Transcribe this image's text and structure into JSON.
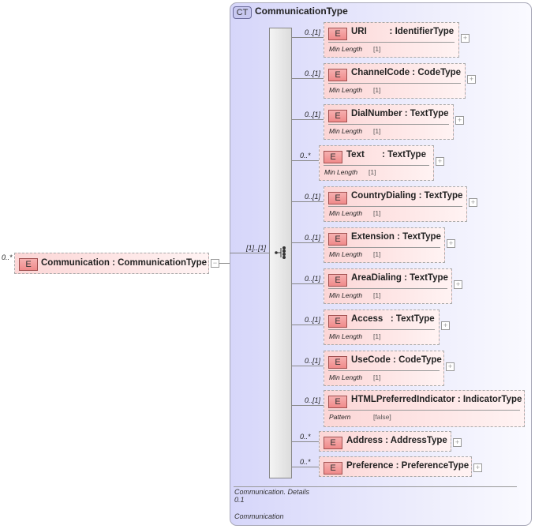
{
  "root": {
    "cardinality": "0..*",
    "badge": "E",
    "name": "Communication : CommunicationType",
    "toggle": "−"
  },
  "complex_type": {
    "badge": "CT",
    "title": "CommunicationType",
    "sequence_cardinality": "[1]..[1]"
  },
  "children": [
    {
      "cardinality": "0..[1]",
      "name": "URI         : IdentifierType",
      "facet": "Min Length",
      "facet_value": "[1]",
      "expand": "+"
    },
    {
      "cardinality": "0..[1]",
      "name": "ChannelCode : CodeType",
      "facet": "Min Length",
      "facet_value": "[1]",
      "expand": "+"
    },
    {
      "cardinality": "0..[1]",
      "name": "DialNumber : TextType",
      "facet": "Min Length",
      "facet_value": "[1]",
      "expand": "+"
    },
    {
      "cardinality": "0..*",
      "name": "Text       : TextType",
      "facet": "Min Length",
      "facet_value": "[1]",
      "expand": "+"
    },
    {
      "cardinality": "0..[1]",
      "name": "CountryDialing : TextType",
      "facet": "Min Length",
      "facet_value": "[1]",
      "expand": "+"
    },
    {
      "cardinality": "0..[1]",
      "name": "Extension : TextType",
      "facet": "Min Length",
      "facet_value": "[1]",
      "expand": "+"
    },
    {
      "cardinality": "0..[1]",
      "name": "AreaDialing : TextType",
      "facet": "Min Length",
      "facet_value": "[1]",
      "expand": "+"
    },
    {
      "cardinality": "0..[1]",
      "name": "Access   : TextType",
      "facet": "Min Length",
      "facet_value": "[1]",
      "expand": "+"
    },
    {
      "cardinality": "0..[1]",
      "name": "UseCode : CodeType",
      "facet": "Min Length",
      "facet_value": "[1]",
      "expand": "+"
    },
    {
      "cardinality": "0..[1]",
      "name": "HTMLPreferredIndicator : IndicatorType",
      "facet": "Pattern",
      "facet_value": "[false]"
    },
    {
      "cardinality": "0..*",
      "name": "Address : AddressType",
      "expand": "+"
    },
    {
      "cardinality": "0..*",
      "name": "Preference : PreferenceType",
      "expand": "+"
    }
  ],
  "footer": {
    "line1": "Communication. Details",
    "line2": "0.1",
    "line3": "Communication"
  }
}
